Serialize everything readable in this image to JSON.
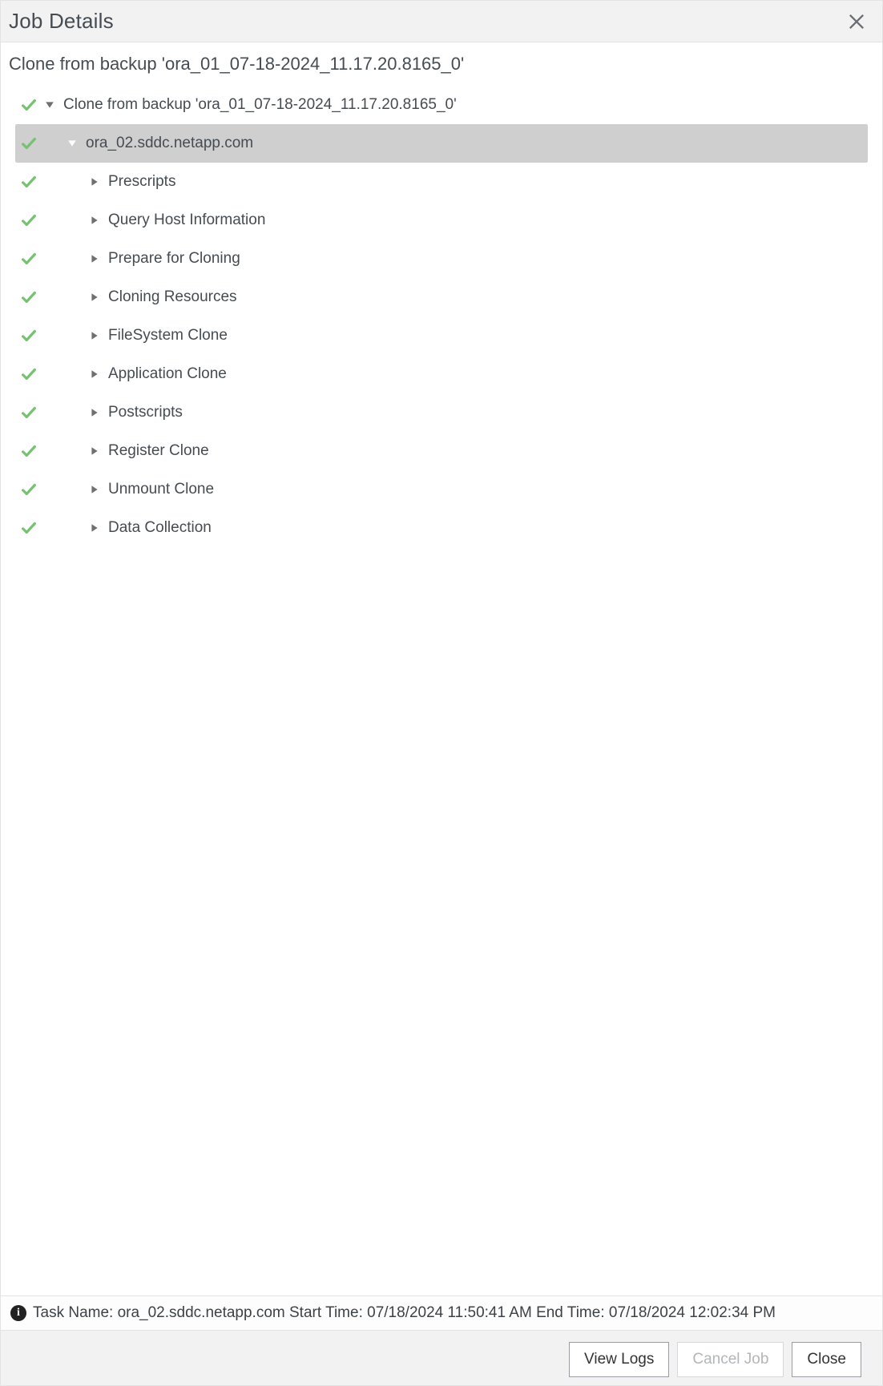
{
  "dialog": {
    "title": "Job Details",
    "subtitle": "Clone from backup 'ora_01_07-18-2024_11.17.20.8165_0'"
  },
  "tree": [
    {
      "level": 0,
      "status": "success",
      "expanded": true,
      "selected": false,
      "label": "Clone from backup 'ora_01_07-18-2024_11.17.20.8165_0'"
    },
    {
      "level": 1,
      "status": "success",
      "expanded": true,
      "selected": true,
      "label": "ora_02.sddc.netapp.com"
    },
    {
      "level": 2,
      "status": "success",
      "expanded": false,
      "selected": false,
      "label": "Prescripts"
    },
    {
      "level": 2,
      "status": "success",
      "expanded": false,
      "selected": false,
      "label": "Query Host Information"
    },
    {
      "level": 2,
      "status": "success",
      "expanded": false,
      "selected": false,
      "label": "Prepare for Cloning"
    },
    {
      "level": 2,
      "status": "success",
      "expanded": false,
      "selected": false,
      "label": "Cloning Resources"
    },
    {
      "level": 2,
      "status": "success",
      "expanded": false,
      "selected": false,
      "label": "FileSystem Clone"
    },
    {
      "level": 2,
      "status": "success",
      "expanded": false,
      "selected": false,
      "label": "Application Clone"
    },
    {
      "level": 2,
      "status": "success",
      "expanded": false,
      "selected": false,
      "label": "Postscripts"
    },
    {
      "level": 2,
      "status": "success",
      "expanded": false,
      "selected": false,
      "label": "Register Clone"
    },
    {
      "level": 2,
      "status": "success",
      "expanded": false,
      "selected": false,
      "label": "Unmount Clone"
    },
    {
      "level": 2,
      "status": "success",
      "expanded": false,
      "selected": false,
      "label": "Data Collection"
    }
  ],
  "status": {
    "text": "Task Name: ora_02.sddc.netapp.com Start Time: 07/18/2024 11:50:41 AM End Time: 07/18/2024 12:02:34 PM"
  },
  "footer": {
    "view_logs": "View Logs",
    "cancel_job": "Cancel Job",
    "close": "Close"
  }
}
